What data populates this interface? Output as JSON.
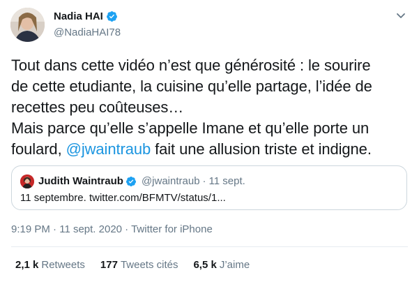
{
  "author": {
    "name": "Nadia HAI",
    "handle": "@NadiaHAI78",
    "verified_color": "#1da1f2"
  },
  "tweet": {
    "line1": "Tout dans cette vidéo n’est que générosité : le sourire",
    "line2": "de cette etudiante, la cuisine qu’elle partage, l’idée de",
    "line3": "recettes peu coûteuses…",
    "line4": "Mais parce qu’elle s’appelle Imane et qu’elle porte un",
    "line5_before": "foulard, ",
    "line5_mention": "@jwaintraub",
    "line5_after": " fait une allusion triste et indigne.",
    "mention_color": "#1b95e0"
  },
  "quote": {
    "name": "Judith Waintraub",
    "handle": "@jwaintraub",
    "separator": "·",
    "date": "11 sept.",
    "text": "11 septembre. twitter.com/BFMTV/status/1..."
  },
  "meta": {
    "time": "9:19 PM",
    "sep1": " · ",
    "date": "11 sept. 2020",
    "sep2": " · ",
    "source": "Twitter for iPhone"
  },
  "stats": [
    {
      "count": "2,1 k",
      "label": "Retweets"
    },
    {
      "count": "177",
      "label": "Tweets cités"
    },
    {
      "count": "6,5 k",
      "label": "J’aime"
    }
  ],
  "icons": {
    "verified": "verified-badge-icon",
    "more": "chevron-down-icon"
  }
}
